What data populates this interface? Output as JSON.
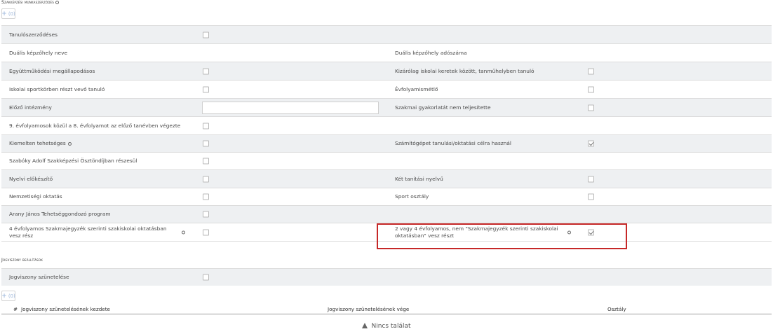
{
  "section1": {
    "title": "Szakképzési munkaszerződés",
    "add_count": "(0)"
  },
  "rows": [
    {
      "left_label": "Tanulószerződéses"
    },
    {
      "left_label": "Duális képzőhely neve",
      "right_label": "Duális képzőhely adószáma"
    },
    {
      "left_label": "Együttműködési megállapodásos",
      "right_label": "Kizárólag iskolai keretek között, tanműhelyben tanuló"
    },
    {
      "left_label": "Iskolai sportkörben részt vevő tanuló",
      "right_label": "Évfolyamismétlő"
    },
    {
      "left_label": "Előző intézmény",
      "left_input_value": "",
      "right_label": "Szakmai gyakorlatát nem teljesítette"
    },
    {
      "left_label": "9. évfolyamosok közül a 8. évfolyamot az előző tanévben végezte"
    },
    {
      "left_label": "Kiemelten tehetséges",
      "right_label": "Számítógépet tanulási/oktatási célra használ",
      "right_checked": true
    },
    {
      "left_label": "Szabóky Adolf Szakképzési Ösztöndíjban részesül"
    },
    {
      "left_label": "Nyelvi előkészítő",
      "right_label": "Két tanítási nyelvű"
    },
    {
      "left_label": "Nemzetiségi oktatás",
      "right_label": "Sport osztály"
    },
    {
      "left_label": "Arany János Tehetséggondozó program"
    },
    {
      "left_label": "4 évfolyamos Szakmajegyzék szerinti szakiskolai oktatásban vesz rész",
      "right_label": "2 vagy 4 évfolyamos, nem \"Szakmajegyzék szerinti szakiskolai oktatásban\" vesz részt",
      "right_checked": true
    }
  ],
  "section2": {
    "title": "Jogviszony beállítások",
    "row_label": "Jogviszony szünetelése",
    "add_count": "(0)",
    "table": {
      "columns": [
        "#",
        "Jogviszony szünetelésének kezdete",
        "Jogviszony szünetelésének vége",
        "Osztály"
      ],
      "empty_text": "Nincs találat"
    }
  },
  "colors": {
    "row_gray": "#eef0f2",
    "highlight": "#c62828",
    "link": "#9bb5d9"
  }
}
